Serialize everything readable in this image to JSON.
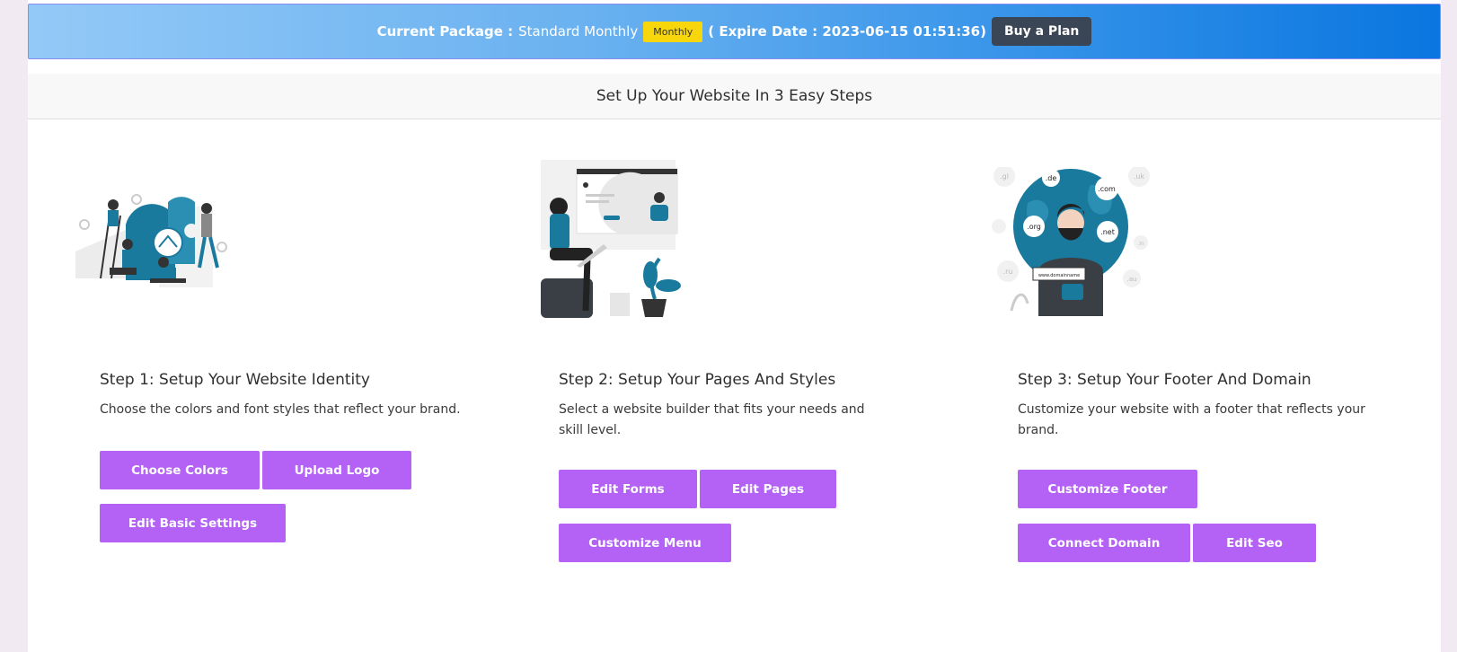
{
  "banner": {
    "current_package_label": "Current Package :",
    "package_name": "Standard Monthly",
    "badge": "Monthly",
    "expire_text": "( Expire Date : 2023-06-15 01:51:36)",
    "buy_button": "Buy a Plan"
  },
  "steps_header": "Set Up Your Website In 3 Easy Steps",
  "domain_tags": [
    ".de",
    ".com",
    ".org",
    ".net",
    ".gl",
    ".uk",
    ".ru",
    ".au",
    ".in",
    "www.domainname"
  ],
  "steps": [
    {
      "title": "Step 1: Setup Your Website Identity",
      "description": "Choose the colors and font styles that reflect your brand.",
      "buttons": [
        "Choose Colors",
        "Upload Logo",
        "Edit Basic Settings"
      ]
    },
    {
      "title": "Step 2: Setup Your Pages And Styles",
      "description": "Select a website builder that fits your needs and skill level.",
      "buttons": [
        "Edit Forms",
        "Edit Pages",
        "Customize Menu"
      ]
    },
    {
      "title": "Step 3: Setup Your Footer And Domain",
      "description": "Customize your website with a footer that reflects your brand.",
      "buttons": [
        "Customize Footer",
        "Connect Domain",
        "Edit Seo"
      ]
    }
  ],
  "colors": {
    "accent_button": "#b461f6",
    "banner_badge": "#f7d70c",
    "illustration_blue": "#1a7a9e"
  }
}
